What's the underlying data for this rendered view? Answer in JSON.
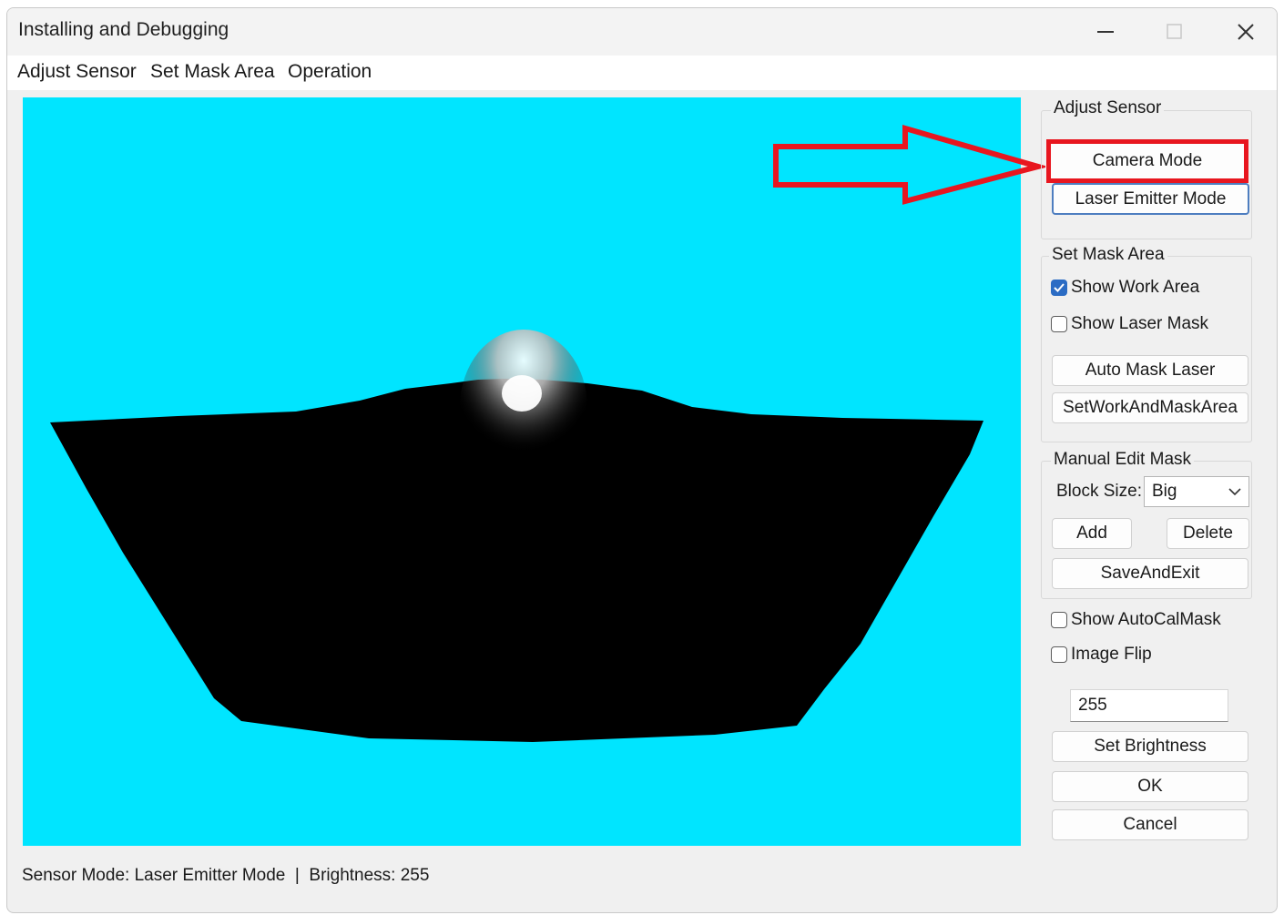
{
  "window": {
    "title": "Installing and Debugging",
    "controls": {
      "minimize": "minimize-icon",
      "maximize": "maximize-icon",
      "close": "close-icon"
    }
  },
  "menu": [
    "Adjust Sensor",
    "Set Mask Area",
    "Operation"
  ],
  "viewport": {
    "background_color": "#00e5ff",
    "surface_color": "#000000"
  },
  "annotation": {
    "arrow_color": "#e8161f",
    "target": "Camera Mode"
  },
  "adjust_sensor": {
    "legend": "Adjust Sensor",
    "camera_mode": "Camera Mode",
    "laser_emitter_mode": "Laser Emitter Mode"
  },
  "set_mask_area": {
    "legend": "Set Mask Area",
    "show_work_area": {
      "label": "Show Work Area",
      "checked": true
    },
    "show_laser_mask": {
      "label": "Show Laser Mask",
      "checked": false
    },
    "auto_mask_laser": "Auto Mask Laser",
    "set_work_and_mask_area": "SetWorkAndMaskArea"
  },
  "manual_edit_mask": {
    "legend": "Manual Edit Mask",
    "block_size_label": "Block Size:",
    "block_size_value": "Big",
    "add": "Add",
    "delete": "Delete",
    "save_and_exit": "SaveAndExit"
  },
  "options": {
    "show_autocalmask": {
      "label": "Show AutoCalMask",
      "checked": false
    },
    "image_flip": {
      "label": "Image Flip",
      "checked": false
    }
  },
  "brightness": {
    "value": "255",
    "set_label": "Set Brightness"
  },
  "dialog": {
    "ok": "OK",
    "cancel": "Cancel"
  },
  "status": "Sensor Mode: Laser Emitter Mode  |  Brightness: 255",
  "colors": {
    "accent": "#2b6cc4",
    "annotation": "#e8161f",
    "focus_border": "#4e7ec0"
  }
}
